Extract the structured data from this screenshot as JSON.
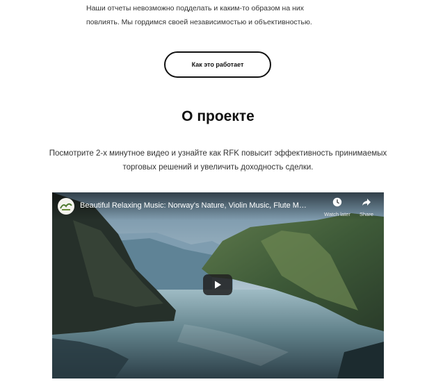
{
  "intro": {
    "text": "Наши отчеты невозможно подделать и каким-то образом на них повлиять. Мы гордимся своей независимостью и объективностью."
  },
  "cta": {
    "label": "Как это работает"
  },
  "about": {
    "title": "О проекте",
    "description": "Посмотрите 2-х минутное видео и узнайте как RFK повысит эффективность принимаемых торговых решений и увеличить доходность сделки."
  },
  "video": {
    "title": "Beautiful Relaxing Music: Norway's Nature, Violin Music, Flute Music...",
    "watch_later_label": "Watch later",
    "share_label": "Share",
    "icons": {
      "channel": "channel-logo-icon",
      "watch_later": "clock-icon",
      "share": "share-arrow-icon",
      "play": "play-icon"
    }
  }
}
